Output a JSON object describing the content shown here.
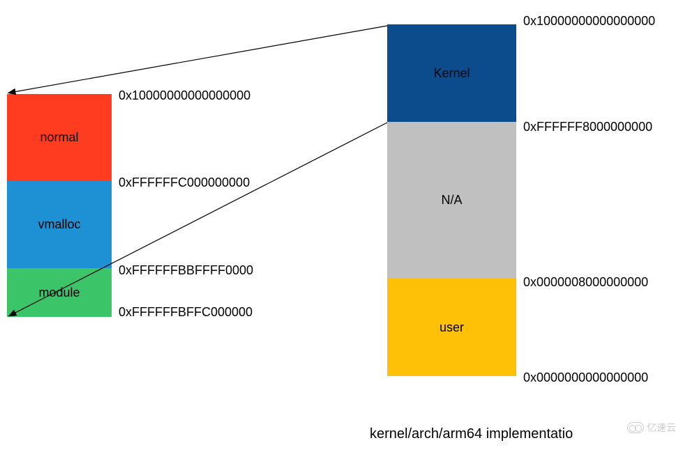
{
  "right_stack": {
    "blocks": [
      {
        "label": "Kernel",
        "color": "#0d4c8c",
        "textColor": "#000"
      },
      {
        "label": "N/A",
        "color": "#c0c0c0",
        "textColor": "#000"
      },
      {
        "label": "user",
        "color": "#ffc107",
        "textColor": "#000"
      }
    ],
    "addresses": [
      "0x10000000000000000",
      "0xFFFFFF8000000000",
      "0x0000008000000000",
      "0x0000000000000000"
    ]
  },
  "left_stack": {
    "blocks": [
      {
        "label": "normal",
        "color": "#ff3c1f",
        "textColor": "#000"
      },
      {
        "label": "vmalloc",
        "color": "#1e90d4",
        "textColor": "#000"
      },
      {
        "label": "module",
        "color": "#3cc468",
        "textColor": "#000"
      }
    ],
    "addresses": [
      "0x10000000000000000",
      "0xFFFFFFC000000000",
      "0xFFFFFFBBFFFF0000",
      "0xFFFFFFBFFC000000"
    ]
  },
  "caption": "kernel/arch/arm64 implementatio",
  "watermark": "亿速云"
}
